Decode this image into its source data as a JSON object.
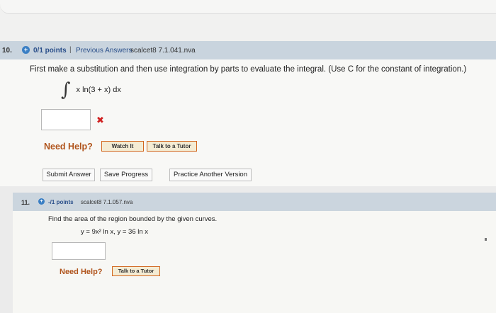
{
  "q10": {
    "number": "10.",
    "points": "0/1 points",
    "separator": "|",
    "previous_answers": "Previous Answers",
    "code": "scalcet8 7.1.041.nva",
    "prompt": "First make a substitution and then use integration by parts to evaluate the integral. (Use C for the constant of integration.)",
    "integral_sign": "∫",
    "integrand": "x ln(3 + x) dx",
    "answer_value": "",
    "wrong_mark": "✖",
    "need_help": "Need Help?",
    "watch_label": "Watch It",
    "tutor_label": "Talk to a Tutor",
    "submit_label": "Submit Answer",
    "save_label": "Save Progress",
    "practice_label": "Practice Another Version"
  },
  "q11": {
    "number": "11.",
    "points": "-/1 points",
    "code": "scalcet8 7.1.057.nva",
    "prompt": "Find the area of the region bounded by the given curves.",
    "curves": "y = 9x² ln x,  y = 36 ln x",
    "answer_value": "",
    "need_help": "Need Help?",
    "tutor_label": "Talk to a Tutor"
  },
  "icons": {
    "status_icon": "plus-circle-icon"
  },
  "colors": {
    "header_bg": "#c9d4de",
    "points_text": "#2a4f8a",
    "need_help": "#b0541c",
    "help_button_border": "#d2671e",
    "wrong_mark": "#d02020"
  }
}
